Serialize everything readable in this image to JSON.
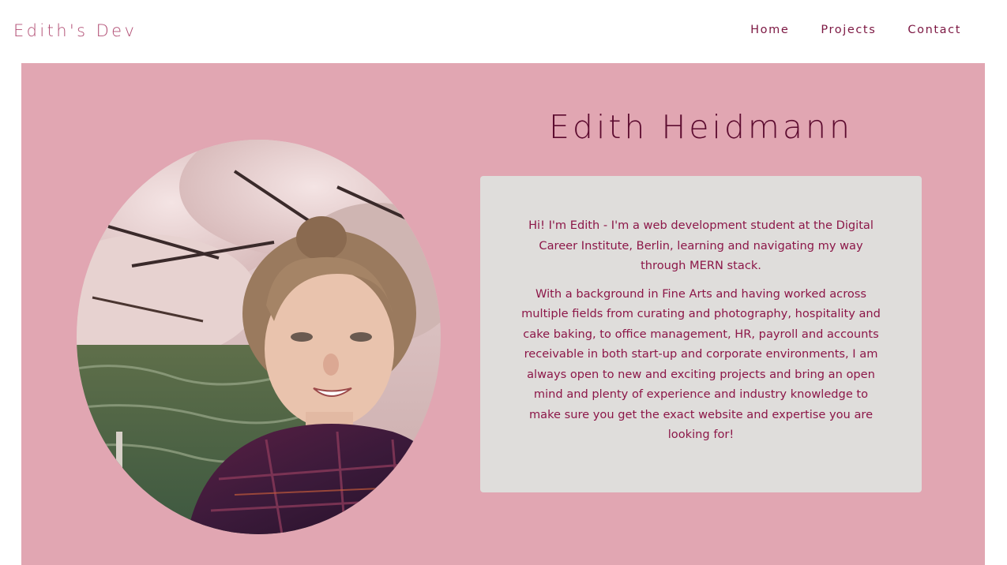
{
  "navbar": {
    "brand": "Edith's Dev",
    "links": [
      {
        "label": "Home"
      },
      {
        "label": "Projects"
      },
      {
        "label": "Contact"
      }
    ]
  },
  "hero": {
    "name": "Edith Heidmann",
    "about": {
      "paragraph_1": "Hi! I'm Edith - I'm a web development student at the Digital Career Institute, Berlin, learning and navigating my way through MERN stack.",
      "paragraph_2": "With a background in Fine Arts and having worked across multiple fields from curating and photography, hospitality and cake baking, to office management, HR, payroll and accounts receivable in both start-up and corporate environments, I am always open to new and exciting projects and bring an open mind and plenty of experience and industry knowledge to make sure you get the exact website and expertise you are looking for!"
    }
  },
  "colors": {
    "hero_background": "#e1a6b2",
    "card_background": "#dfdddb",
    "brand_text": "#b14d73",
    "accent_text": "#8c1748",
    "heading_text": "#5c0b2f"
  },
  "icons": {
    "portrait": "portrait-photo"
  }
}
